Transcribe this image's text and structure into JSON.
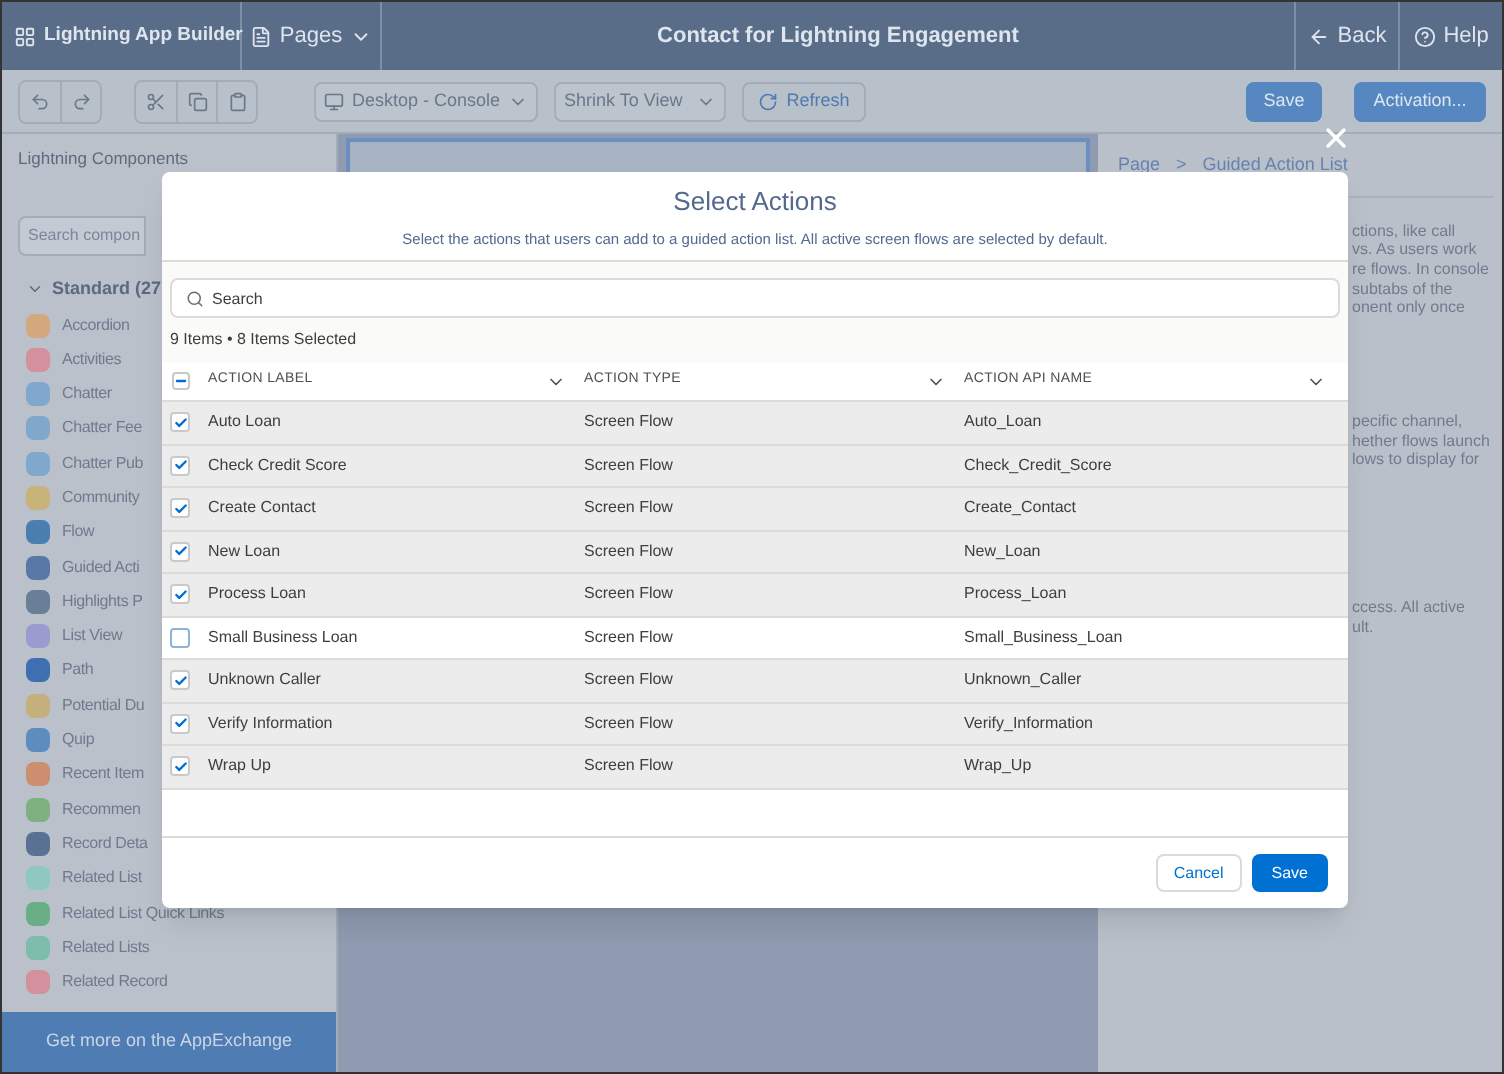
{
  "header": {
    "app_name": "Lightning App Builder",
    "pages": "Pages",
    "title": "Contact for Lightning Engagement",
    "back": "Back",
    "help": "Help"
  },
  "toolbar": {
    "view": "Desktop - Console",
    "zoom": "Shrink To View",
    "refresh": "Refresh",
    "save": "Save",
    "activation": "Activation..."
  },
  "sidebar": {
    "title": "Lightning Components",
    "search_placeholder": "Search compon",
    "section": "Standard (27",
    "items": [
      {
        "label": "Accordion",
        "color": "#d4a87c"
      },
      {
        "label": "Activities",
        "color": "#d4909c"
      },
      {
        "label": "Chatter",
        "color": "#7fa8cc"
      },
      {
        "label": "Chatter Fee",
        "color": "#7fa8cc"
      },
      {
        "label": "Chatter Pub",
        "color": "#7fa8cc"
      },
      {
        "label": "Community",
        "color": "#c8b47a"
      },
      {
        "label": "Flow",
        "color": "#4a7db0"
      },
      {
        "label": "Guided Acti",
        "color": "#5a78a6"
      },
      {
        "label": "Highlights P",
        "color": "#6a7e98"
      },
      {
        "label": "List View",
        "color": "#9a9ccf"
      },
      {
        "label": "Path",
        "color": "#3f6fb3"
      },
      {
        "label": "Potential Du",
        "color": "#c4b07a"
      },
      {
        "label": "Quip",
        "color": "#5d8cbe"
      },
      {
        "label": "Recent Item",
        "color": "#cd8e70"
      },
      {
        "label": "Recommen",
        "color": "#7fb07f"
      },
      {
        "label": "Record Deta",
        "color": "#5a7196"
      },
      {
        "label": "Related List",
        "color": "#8fc8c0"
      },
      {
        "label": "Related List Quick Links",
        "color": "#6aae88"
      },
      {
        "label": "Related Lists",
        "color": "#7dbdab"
      },
      {
        "label": "Related Record",
        "color": "#d4909c"
      }
    ],
    "footer": "Get more on the AppExchange"
  },
  "properties": {
    "breadcrumb_page": "Page",
    "breadcrumb_sep": ">",
    "breadcrumb_item": "Guided Action List",
    "lines_1": [
      "ctions, like call",
      "vs. As users work",
      "re flows. In console",
      "subtabs of the",
      "onent only once"
    ],
    "lines_2": [
      "pecific channel,",
      "hether flows launch",
      "lows to display for"
    ],
    "lines_3": [
      "ccess. All active",
      "ult."
    ]
  },
  "modal": {
    "title": "Select Actions",
    "subtitle": "Select the actions that users can add to a guided action list. All active screen flows are selected by default.",
    "search_placeholder": "Search",
    "count": "9 Items • 8 Items Selected",
    "select_all_indeterminate": true,
    "columns": [
      "ACTION LABEL",
      "ACTION TYPE",
      "ACTION API NAME"
    ],
    "rows": [
      {
        "label": "Auto Loan",
        "type": "Screen Flow",
        "api": "Auto_Loan",
        "checked": true
      },
      {
        "label": "Check Credit Score",
        "type": "Screen Flow",
        "api": "Check_Credit_Score",
        "checked": true
      },
      {
        "label": "Create Contact",
        "type": "Screen Flow",
        "api": "Create_Contact",
        "checked": true
      },
      {
        "label": "New Loan",
        "type": "Screen Flow",
        "api": "New_Loan",
        "checked": true
      },
      {
        "label": "Process Loan",
        "type": "Screen Flow",
        "api": "Process_Loan",
        "checked": true
      },
      {
        "label": "Small Business Loan",
        "type": "Screen Flow",
        "api": "Small_Business_Loan",
        "checked": false
      },
      {
        "label": "Unknown Caller",
        "type": "Screen Flow",
        "api": "Unknown_Caller",
        "checked": true
      },
      {
        "label": "Verify Information",
        "type": "Screen Flow",
        "api": "Verify_Information",
        "checked": true
      },
      {
        "label": "Wrap Up",
        "type": "Screen Flow",
        "api": "Wrap_Up",
        "checked": true
      }
    ],
    "cancel": "Cancel",
    "save": "Save"
  }
}
